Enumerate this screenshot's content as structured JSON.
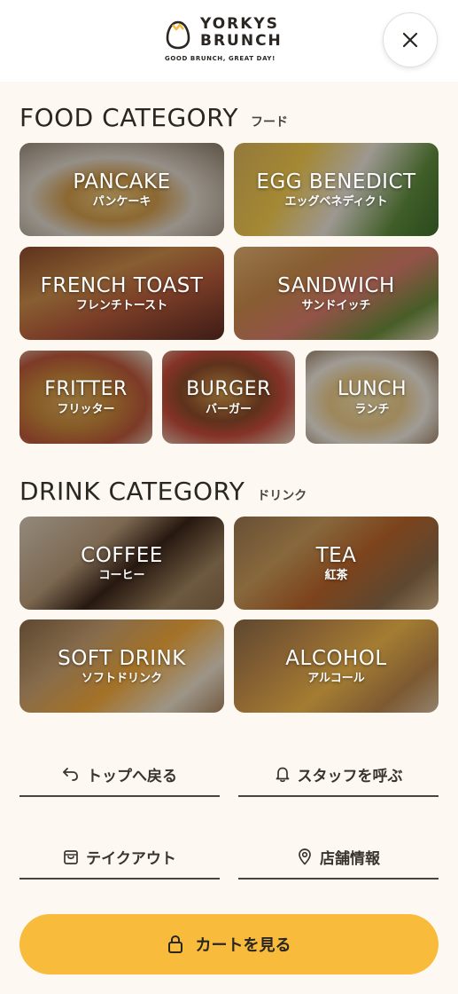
{
  "brand": {
    "line1": "YORKYS",
    "line2": "BRUNCH",
    "tagline": "GOOD BRUNCH, GREAT DAY!"
  },
  "header": {
    "close_icon": "close-icon"
  },
  "food": {
    "title": "FOOD CATEGORY",
    "subtitle": "フード",
    "items": [
      {
        "en": "PANCAKE",
        "ja": "パンケーキ"
      },
      {
        "en": "EGG BENEDICT",
        "ja": "エッグベネディクト"
      },
      {
        "en": "FRENCH TOAST",
        "ja": "フレンチトースト"
      },
      {
        "en": "SANDWICH",
        "ja": "サンドイッチ"
      },
      {
        "en": "FRITTER",
        "ja": "フリッター"
      },
      {
        "en": "BURGER",
        "ja": "バーガー"
      },
      {
        "en": "LUNCH",
        "ja": "ランチ"
      }
    ]
  },
  "drink": {
    "title": "DRINK CATEGORY",
    "subtitle": "ドリンク",
    "items": [
      {
        "en": "COFFEE",
        "ja": "コーヒー"
      },
      {
        "en": "TEA",
        "ja": "紅茶"
      },
      {
        "en": "SOFT DRINK",
        "ja": "ソフトドリンク"
      },
      {
        "en": "ALCOHOL",
        "ja": "アルコール"
      }
    ]
  },
  "nav": {
    "top": "トップへ戻る",
    "staff": "スタッフを呼ぶ",
    "takeout": "テイクアウト",
    "store": "店舗情報"
  },
  "cart": {
    "label": "カートを見る"
  },
  "colors": {
    "accent": "#f8bb3b",
    "background": "#fdf9f2"
  }
}
